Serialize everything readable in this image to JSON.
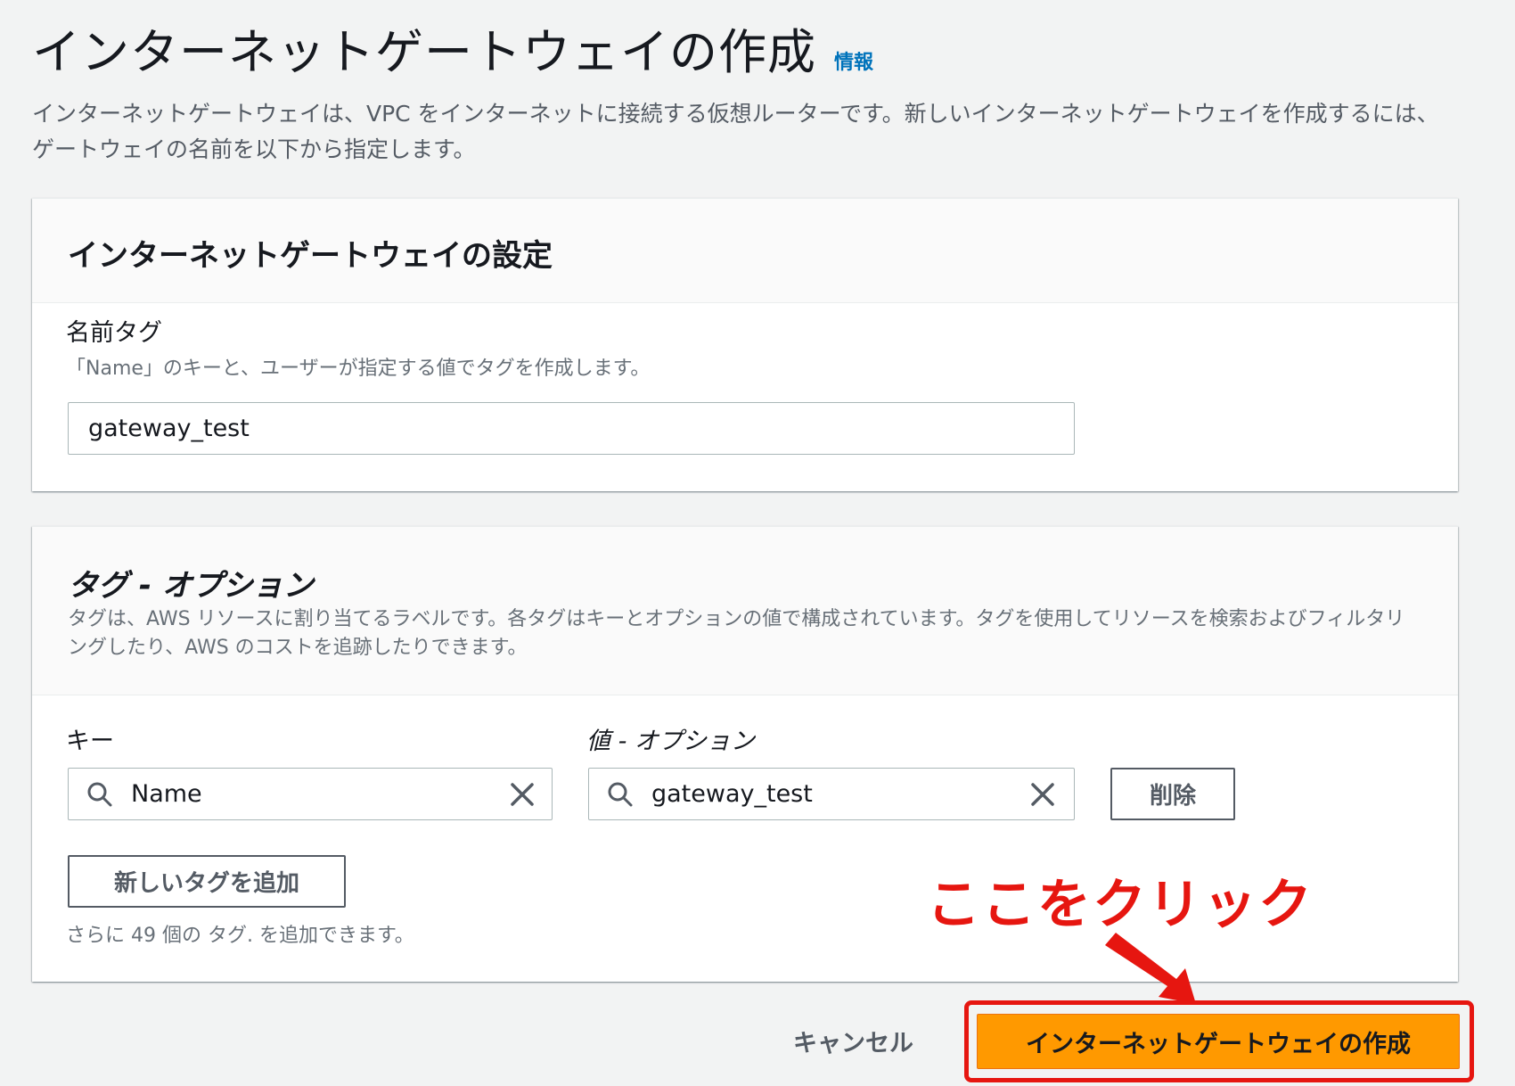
{
  "header": {
    "title": "インターネットゲートウェイの作成",
    "info_link": "情報",
    "description": "インターネットゲートウェイは、VPC をインターネットに接続する仮想ルーターです。新しいインターネットゲートウェイを作成するには、ゲートウェイの名前を以下から指定します。"
  },
  "settings_panel": {
    "title": "インターネットゲートウェイの設定",
    "name_tag": {
      "label": "名前タグ",
      "description": "「Name」のキーと、ユーザーが指定する値でタグを作成します。",
      "value": "gateway_test"
    }
  },
  "tags_panel": {
    "title": "タグ - オプション",
    "description": "タグは、AWS リソースに割り当てるラベルです。各タグはキーとオプションの値で構成されています。タグを使用してリソースを検索およびフィルタリングしたり、AWS のコストを追跡したりできます。",
    "key_label": "キー",
    "value_label": "値 - オプション",
    "tags": [
      {
        "key": "Name",
        "value": "gateway_test"
      }
    ],
    "remove_label": "削除",
    "add_tag_label": "新しいタグを追加",
    "limit_text": "さらに 49 個の タグ. を追加できます。"
  },
  "footer": {
    "cancel_label": "キャンセル",
    "create_label": "インターネットゲートウェイの作成"
  },
  "annotation": {
    "text": "ここをクリック",
    "color": "#e61610"
  },
  "colors": {
    "primary_button": "#ff9900",
    "link": "#0073bb",
    "background": "#f2f3f3"
  }
}
